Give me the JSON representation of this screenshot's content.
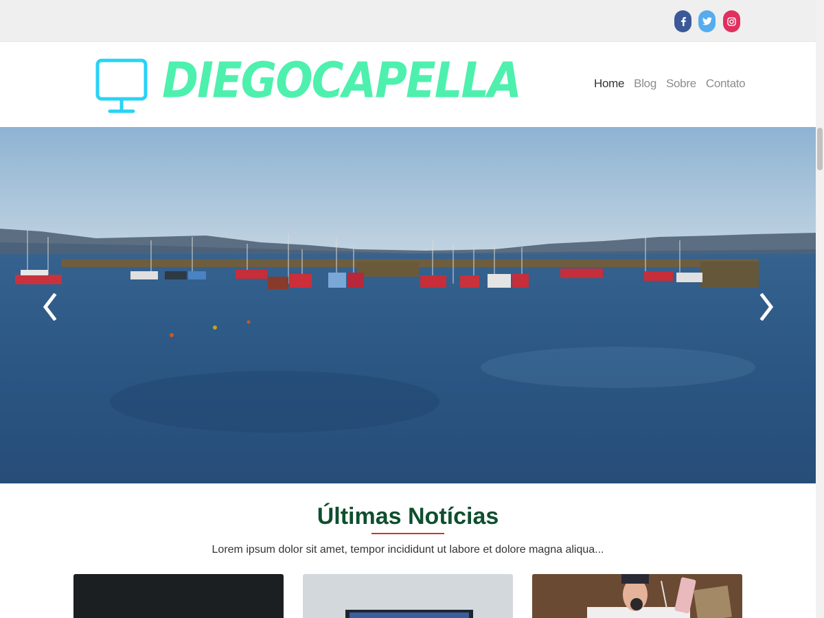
{
  "social": {
    "facebook": "facebook-icon",
    "twitter": "twitter-icon",
    "instagram": "instagram-icon"
  },
  "header": {
    "logo_text": "DIEGOCAPELLA",
    "logo_icon": "monitor-icon",
    "nav": [
      "Home",
      "Blog",
      "Sobre",
      "Contato"
    ],
    "active_nav": "Home"
  },
  "hero": {
    "prev_icon": "chevron-left-icon",
    "next_icon": "chevron-right-icon"
  },
  "news": {
    "title": "Últimas Notícias",
    "subtitle": "Lorem ipsum dolor sit amet, tempor incididunt ut labore et dolore magna aliqua..."
  },
  "colors": {
    "logo": "#4ef0ae",
    "logo_icon": "#29d3f5",
    "news_title": "#0f4f2e",
    "underline": "#d0332d"
  }
}
